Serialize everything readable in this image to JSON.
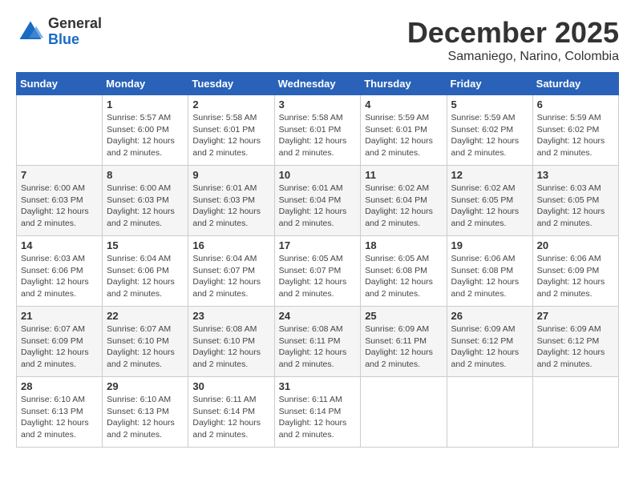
{
  "header": {
    "logo": {
      "general": "General",
      "blue": "Blue"
    },
    "title": "December 2025",
    "subtitle": "Samaniego, Narino, Colombia"
  },
  "calendar": {
    "days_of_week": [
      "Sunday",
      "Monday",
      "Tuesday",
      "Wednesday",
      "Thursday",
      "Friday",
      "Saturday"
    ],
    "weeks": [
      [
        {
          "day": "",
          "info": ""
        },
        {
          "day": "1",
          "info": "Sunrise: 5:57 AM\nSunset: 6:00 PM\nDaylight: 12 hours\nand 2 minutes."
        },
        {
          "day": "2",
          "info": "Sunrise: 5:58 AM\nSunset: 6:01 PM\nDaylight: 12 hours\nand 2 minutes."
        },
        {
          "day": "3",
          "info": "Sunrise: 5:58 AM\nSunset: 6:01 PM\nDaylight: 12 hours\nand 2 minutes."
        },
        {
          "day": "4",
          "info": "Sunrise: 5:59 AM\nSunset: 6:01 PM\nDaylight: 12 hours\nand 2 minutes."
        },
        {
          "day": "5",
          "info": "Sunrise: 5:59 AM\nSunset: 6:02 PM\nDaylight: 12 hours\nand 2 minutes."
        },
        {
          "day": "6",
          "info": "Sunrise: 5:59 AM\nSunset: 6:02 PM\nDaylight: 12 hours\nand 2 minutes."
        }
      ],
      [
        {
          "day": "7",
          "info": "Sunrise: 6:00 AM\nSunset: 6:03 PM\nDaylight: 12 hours\nand 2 minutes."
        },
        {
          "day": "8",
          "info": "Sunrise: 6:00 AM\nSunset: 6:03 PM\nDaylight: 12 hours\nand 2 minutes."
        },
        {
          "day": "9",
          "info": "Sunrise: 6:01 AM\nSunset: 6:03 PM\nDaylight: 12 hours\nand 2 minutes."
        },
        {
          "day": "10",
          "info": "Sunrise: 6:01 AM\nSunset: 6:04 PM\nDaylight: 12 hours\nand 2 minutes."
        },
        {
          "day": "11",
          "info": "Sunrise: 6:02 AM\nSunset: 6:04 PM\nDaylight: 12 hours\nand 2 minutes."
        },
        {
          "day": "12",
          "info": "Sunrise: 6:02 AM\nSunset: 6:05 PM\nDaylight: 12 hours\nand 2 minutes."
        },
        {
          "day": "13",
          "info": "Sunrise: 6:03 AM\nSunset: 6:05 PM\nDaylight: 12 hours\nand 2 minutes."
        }
      ],
      [
        {
          "day": "14",
          "info": "Sunrise: 6:03 AM\nSunset: 6:06 PM\nDaylight: 12 hours\nand 2 minutes."
        },
        {
          "day": "15",
          "info": "Sunrise: 6:04 AM\nSunset: 6:06 PM\nDaylight: 12 hours\nand 2 minutes."
        },
        {
          "day": "16",
          "info": "Sunrise: 6:04 AM\nSunset: 6:07 PM\nDaylight: 12 hours\nand 2 minutes."
        },
        {
          "day": "17",
          "info": "Sunrise: 6:05 AM\nSunset: 6:07 PM\nDaylight: 12 hours\nand 2 minutes."
        },
        {
          "day": "18",
          "info": "Sunrise: 6:05 AM\nSunset: 6:08 PM\nDaylight: 12 hours\nand 2 minutes."
        },
        {
          "day": "19",
          "info": "Sunrise: 6:06 AM\nSunset: 6:08 PM\nDaylight: 12 hours\nand 2 minutes."
        },
        {
          "day": "20",
          "info": "Sunrise: 6:06 AM\nSunset: 6:09 PM\nDaylight: 12 hours\nand 2 minutes."
        }
      ],
      [
        {
          "day": "21",
          "info": "Sunrise: 6:07 AM\nSunset: 6:09 PM\nDaylight: 12 hours\nand 2 minutes."
        },
        {
          "day": "22",
          "info": "Sunrise: 6:07 AM\nSunset: 6:10 PM\nDaylight: 12 hours\nand 2 minutes."
        },
        {
          "day": "23",
          "info": "Sunrise: 6:08 AM\nSunset: 6:10 PM\nDaylight: 12 hours\nand 2 minutes."
        },
        {
          "day": "24",
          "info": "Sunrise: 6:08 AM\nSunset: 6:11 PM\nDaylight: 12 hours\nand 2 minutes."
        },
        {
          "day": "25",
          "info": "Sunrise: 6:09 AM\nSunset: 6:11 PM\nDaylight: 12 hours\nand 2 minutes."
        },
        {
          "day": "26",
          "info": "Sunrise: 6:09 AM\nSunset: 6:12 PM\nDaylight: 12 hours\nand 2 minutes."
        },
        {
          "day": "27",
          "info": "Sunrise: 6:09 AM\nSunset: 6:12 PM\nDaylight: 12 hours\nand 2 minutes."
        }
      ],
      [
        {
          "day": "28",
          "info": "Sunrise: 6:10 AM\nSunset: 6:13 PM\nDaylight: 12 hours\nand 2 minutes."
        },
        {
          "day": "29",
          "info": "Sunrise: 6:10 AM\nSunset: 6:13 PM\nDaylight: 12 hours\nand 2 minutes."
        },
        {
          "day": "30",
          "info": "Sunrise: 6:11 AM\nSunset: 6:14 PM\nDaylight: 12 hours\nand 2 minutes."
        },
        {
          "day": "31",
          "info": "Sunrise: 6:11 AM\nSunset: 6:14 PM\nDaylight: 12 hours\nand 2 minutes."
        },
        {
          "day": "",
          "info": ""
        },
        {
          "day": "",
          "info": ""
        },
        {
          "day": "",
          "info": ""
        }
      ]
    ]
  }
}
